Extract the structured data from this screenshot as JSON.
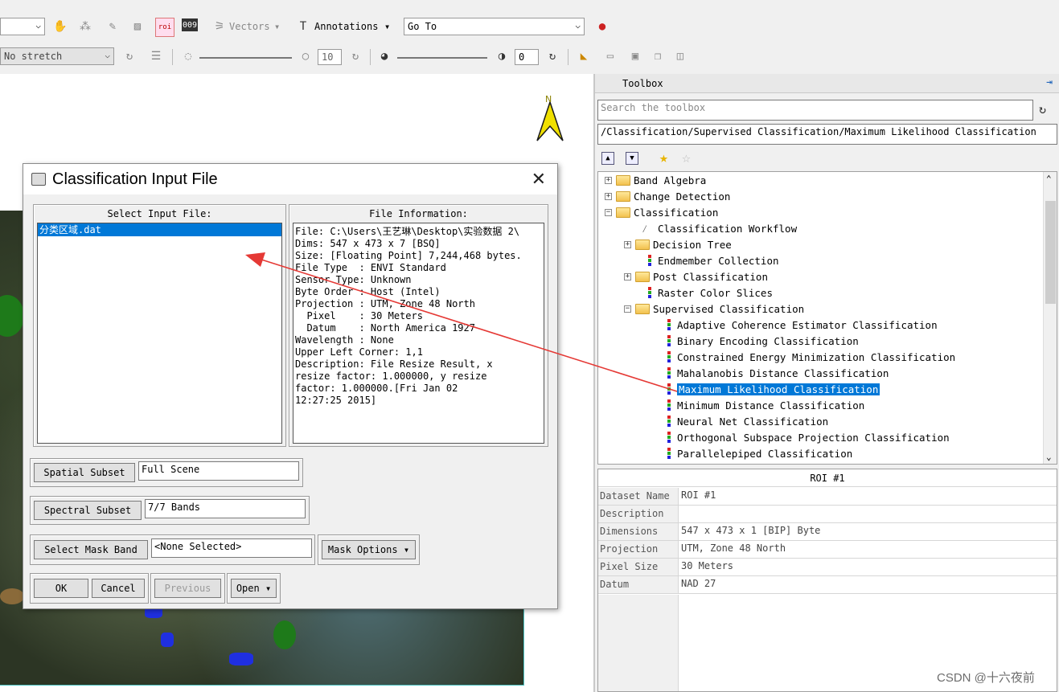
{
  "toolbar": {
    "vectors_label": "Vectors",
    "annotations_label": "Annotations",
    "goto_value": "Go To",
    "stretch_value": "No stretch",
    "sharpen_value": "10",
    "transparency_value": "0"
  },
  "canvas": {
    "north_label": "N"
  },
  "dialog": {
    "title": "Classification Input File",
    "select_input_header": "Select Input File:",
    "input_files": [
      "分类区域.dat"
    ],
    "file_info_header": "File Information:",
    "file_info_lines": [
      "File: C:\\Users\\王艺琳\\Desktop\\实验数据 2\\",
      "Dims: 547 x 473 x 7 [BSQ]",
      "Size: [Floating Point] 7,244,468 bytes.",
      "File Type  : ENVI Standard",
      "Sensor Type: Unknown",
      "Byte Order : Host (Intel)",
      "Projection : UTM, Zone 48 North",
      "  Pixel    : 30 Meters",
      "  Datum    : North America 1927",
      "Wavelength : None",
      "Upper Left Corner: 1,1",
      "Description: File Resize Result, x",
      "resize factor: 1.000000, y resize",
      "factor: 1.000000.[Fri Jan 02",
      "12:27:25 2015]"
    ],
    "spatial_subset_label": "Spatial Subset",
    "spatial_subset_value": "Full Scene",
    "spectral_subset_label": "Spectral Subset",
    "spectral_subset_value": "7/7 Bands",
    "mask_band_label": "Select Mask Band",
    "mask_band_value": "<None Selected>",
    "mask_options_label": "Mask Options",
    "ok_label": "OK",
    "cancel_label": "Cancel",
    "previous_label": "Previous",
    "open_label": "Open"
  },
  "toolbox": {
    "title": "Toolbox",
    "search_placeholder": "Search the toolbox",
    "path": "/Classification/Supervised Classification/Maximum Likelihood Classification",
    "tree": {
      "band_algebra": "Band Algebra",
      "change_detection": "Change Detection",
      "classification": "Classification",
      "classification_workflow": "Classification Workflow",
      "decision_tree": "Decision Tree",
      "endmember_collection": "Endmember Collection",
      "post_classification": "Post Classification",
      "raster_color_slices": "Raster Color Slices",
      "supervised_classification": "Supervised Classification",
      "supervised_items": [
        "Adaptive Coherence Estimator Classification",
        "Binary Encoding Classification",
        "Constrained Energy Minimization Classification",
        "Mahalanobis Distance Classification",
        "Maximum Likelihood Classification",
        "Minimum Distance Classification",
        "Neural Net Classification",
        "Orthogonal Subspace Projection Classification",
        "Parallelepiped Classification"
      ]
    },
    "properties": {
      "header": "ROI #1",
      "rows": [
        {
          "key": "Dataset Name",
          "value": "ROI #1"
        },
        {
          "key": "Description",
          "value": ""
        },
        {
          "key": "Dimensions",
          "value": "547 x 473 x 1 [BIP] Byte"
        },
        {
          "key": "Projection",
          "value": "UTM, Zone 48 North"
        },
        {
          "key": "Pixel Size",
          "value": "30 Meters"
        },
        {
          "key": "Datum",
          "value": "NAD 27"
        }
      ]
    }
  },
  "watermark": "CSDN @十六夜前",
  "colors": {
    "selection": "#0078d7",
    "arrow": "#e53935",
    "roi_green": "#1e7a1a",
    "roi_blue": "#1f2fe0"
  }
}
